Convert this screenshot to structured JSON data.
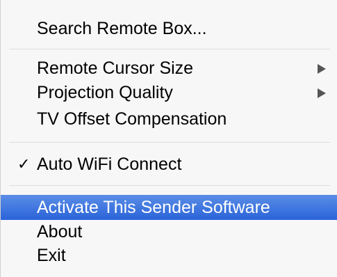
{
  "menu": {
    "search": "Search Remote Box...",
    "cursor_size": "Remote Cursor Size",
    "projection_quality": "Projection Quality",
    "tv_offset": "TV Offset Compensation",
    "check_mark": "✓",
    "auto_wifi": "Auto WiFi Connect",
    "activate": "Activate This Sender Software",
    "about": "About",
    "exit": "Exit"
  },
  "icons": {
    "submenu_arrow": "submenu-arrow-icon",
    "check": "checkmark-icon"
  },
  "colors": {
    "highlight": "#2a63d9",
    "background": "#f7f7f7"
  }
}
